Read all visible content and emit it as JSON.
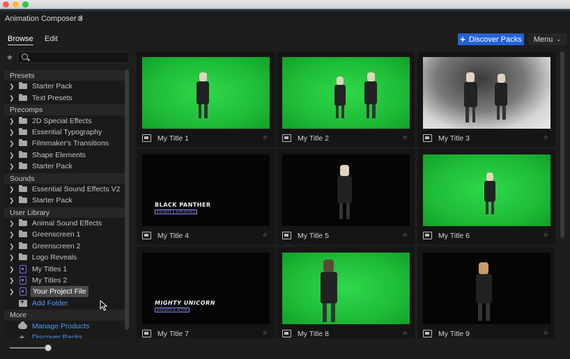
{
  "window": {
    "title": "Animation Composer 3"
  },
  "tabs": {
    "browse": "Browse",
    "edit": "Edit"
  },
  "toolbar": {
    "discover": "Discover Packs",
    "menu": "Menu"
  },
  "search": {
    "value": "",
    "placeholder": ""
  },
  "sidebar": {
    "sections": [
      {
        "header": "Presets",
        "items": [
          {
            "label": "Starter Pack",
            "icon": "folder-icon"
          },
          {
            "label": "Text Presets",
            "icon": "folder-icon"
          }
        ]
      },
      {
        "header": "Precomps",
        "items": [
          {
            "label": "2D Special Effects",
            "icon": "folder-icon"
          },
          {
            "label": "Essential Typography",
            "icon": "folder-icon"
          },
          {
            "label": "Filmmaker's Transitions",
            "icon": "folder-icon"
          },
          {
            "label": "Shape Elements",
            "icon": "folder-icon"
          },
          {
            "label": "Starter Pack",
            "icon": "folder-icon"
          }
        ]
      },
      {
        "header": "Sounds",
        "items": [
          {
            "label": "Essential Sound Effects V2",
            "icon": "folder-icon"
          },
          {
            "label": "Starter Pack",
            "icon": "folder-icon"
          }
        ]
      },
      {
        "header": "User Library",
        "items": [
          {
            "label": "Animal Sound Effects",
            "icon": "folder-icon"
          },
          {
            "label": "Greenscreen 1",
            "icon": "folder-icon"
          },
          {
            "label": "Greenscreen 2",
            "icon": "folder-icon"
          },
          {
            "label": "Logo Reveals",
            "icon": "folder-icon"
          },
          {
            "label": "My Titles 1",
            "icon": "project-file-icon"
          },
          {
            "label": "My Titles 2",
            "icon": "project-file-icon"
          },
          {
            "label": "Your Project File",
            "icon": "project-file-icon",
            "selected": true
          }
        ]
      }
    ],
    "add_folder": "Add Folder",
    "more": {
      "header": "More",
      "manage_products": "Manage Products",
      "discover_packs": "Discover Packs"
    }
  },
  "grid": {
    "items": [
      {
        "title": "My Title 1",
        "thumb": "green"
      },
      {
        "title": "My Title 2",
        "thumb": "green"
      },
      {
        "title": "My Title 3",
        "thumb": "smoke"
      },
      {
        "title": "My Title 4",
        "thumb": "black",
        "brand": "BLACK PANTHER",
        "brand_sub": "ROCKETS & EXPLOSIVES"
      },
      {
        "title": "My Title 5",
        "thumb": "black"
      },
      {
        "title": "My Title 6",
        "thumb": "green"
      },
      {
        "title": "My Title 7",
        "thumb": "black",
        "brand": "MIGHTY UNICORN",
        "brand_sub": "OUGHATH & ACTOR"
      },
      {
        "title": "My Title 8",
        "thumb": "green"
      },
      {
        "title": "My Title 9",
        "thumb": "black"
      }
    ]
  },
  "zoom": {
    "level": 0.9
  },
  "colors": {
    "accent": "#2463d6",
    "link": "#4d9bff",
    "project": "#7b6ad6"
  }
}
